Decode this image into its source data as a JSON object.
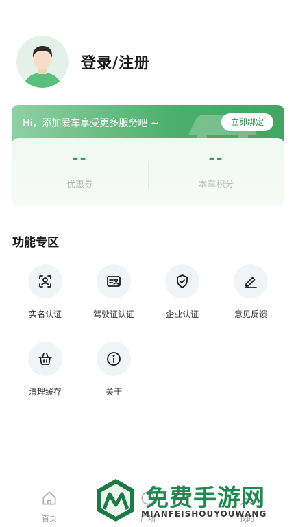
{
  "profile": {
    "login_label": "登录/注册"
  },
  "card": {
    "tip": "Hi，添加爱车享受更多服务吧 ~",
    "bind_button": "立即绑定",
    "stats": [
      {
        "value": "--",
        "label": "优惠券"
      },
      {
        "value": "--",
        "label": "本车积分"
      }
    ]
  },
  "features": {
    "title": "功能专区",
    "items": [
      {
        "label": "实名认证",
        "icon": "face-scan-icon"
      },
      {
        "label": "驾驶证认证",
        "icon": "id-card-icon"
      },
      {
        "label": "企业认证",
        "icon": "shield-check-icon"
      },
      {
        "label": "意见反馈",
        "icon": "pencil-icon"
      },
      {
        "label": "清理缓存",
        "icon": "basket-icon"
      },
      {
        "label": "关于",
        "icon": "info-icon"
      }
    ]
  },
  "tabbar": {
    "items": [
      {
        "label": "首页",
        "icon": "home-icon"
      },
      {
        "label": "广场",
        "icon": "square-icon"
      },
      {
        "label": "我的",
        "icon": "user-icon"
      }
    ]
  },
  "watermark": {
    "title": "免费手游网",
    "subtitle": "MIANFEISHOUYOUWANG"
  },
  "colors": {
    "accent": "#4caf6b",
    "stat_value": "#3f9a5d",
    "icon_bg": "#f2f3f4"
  }
}
